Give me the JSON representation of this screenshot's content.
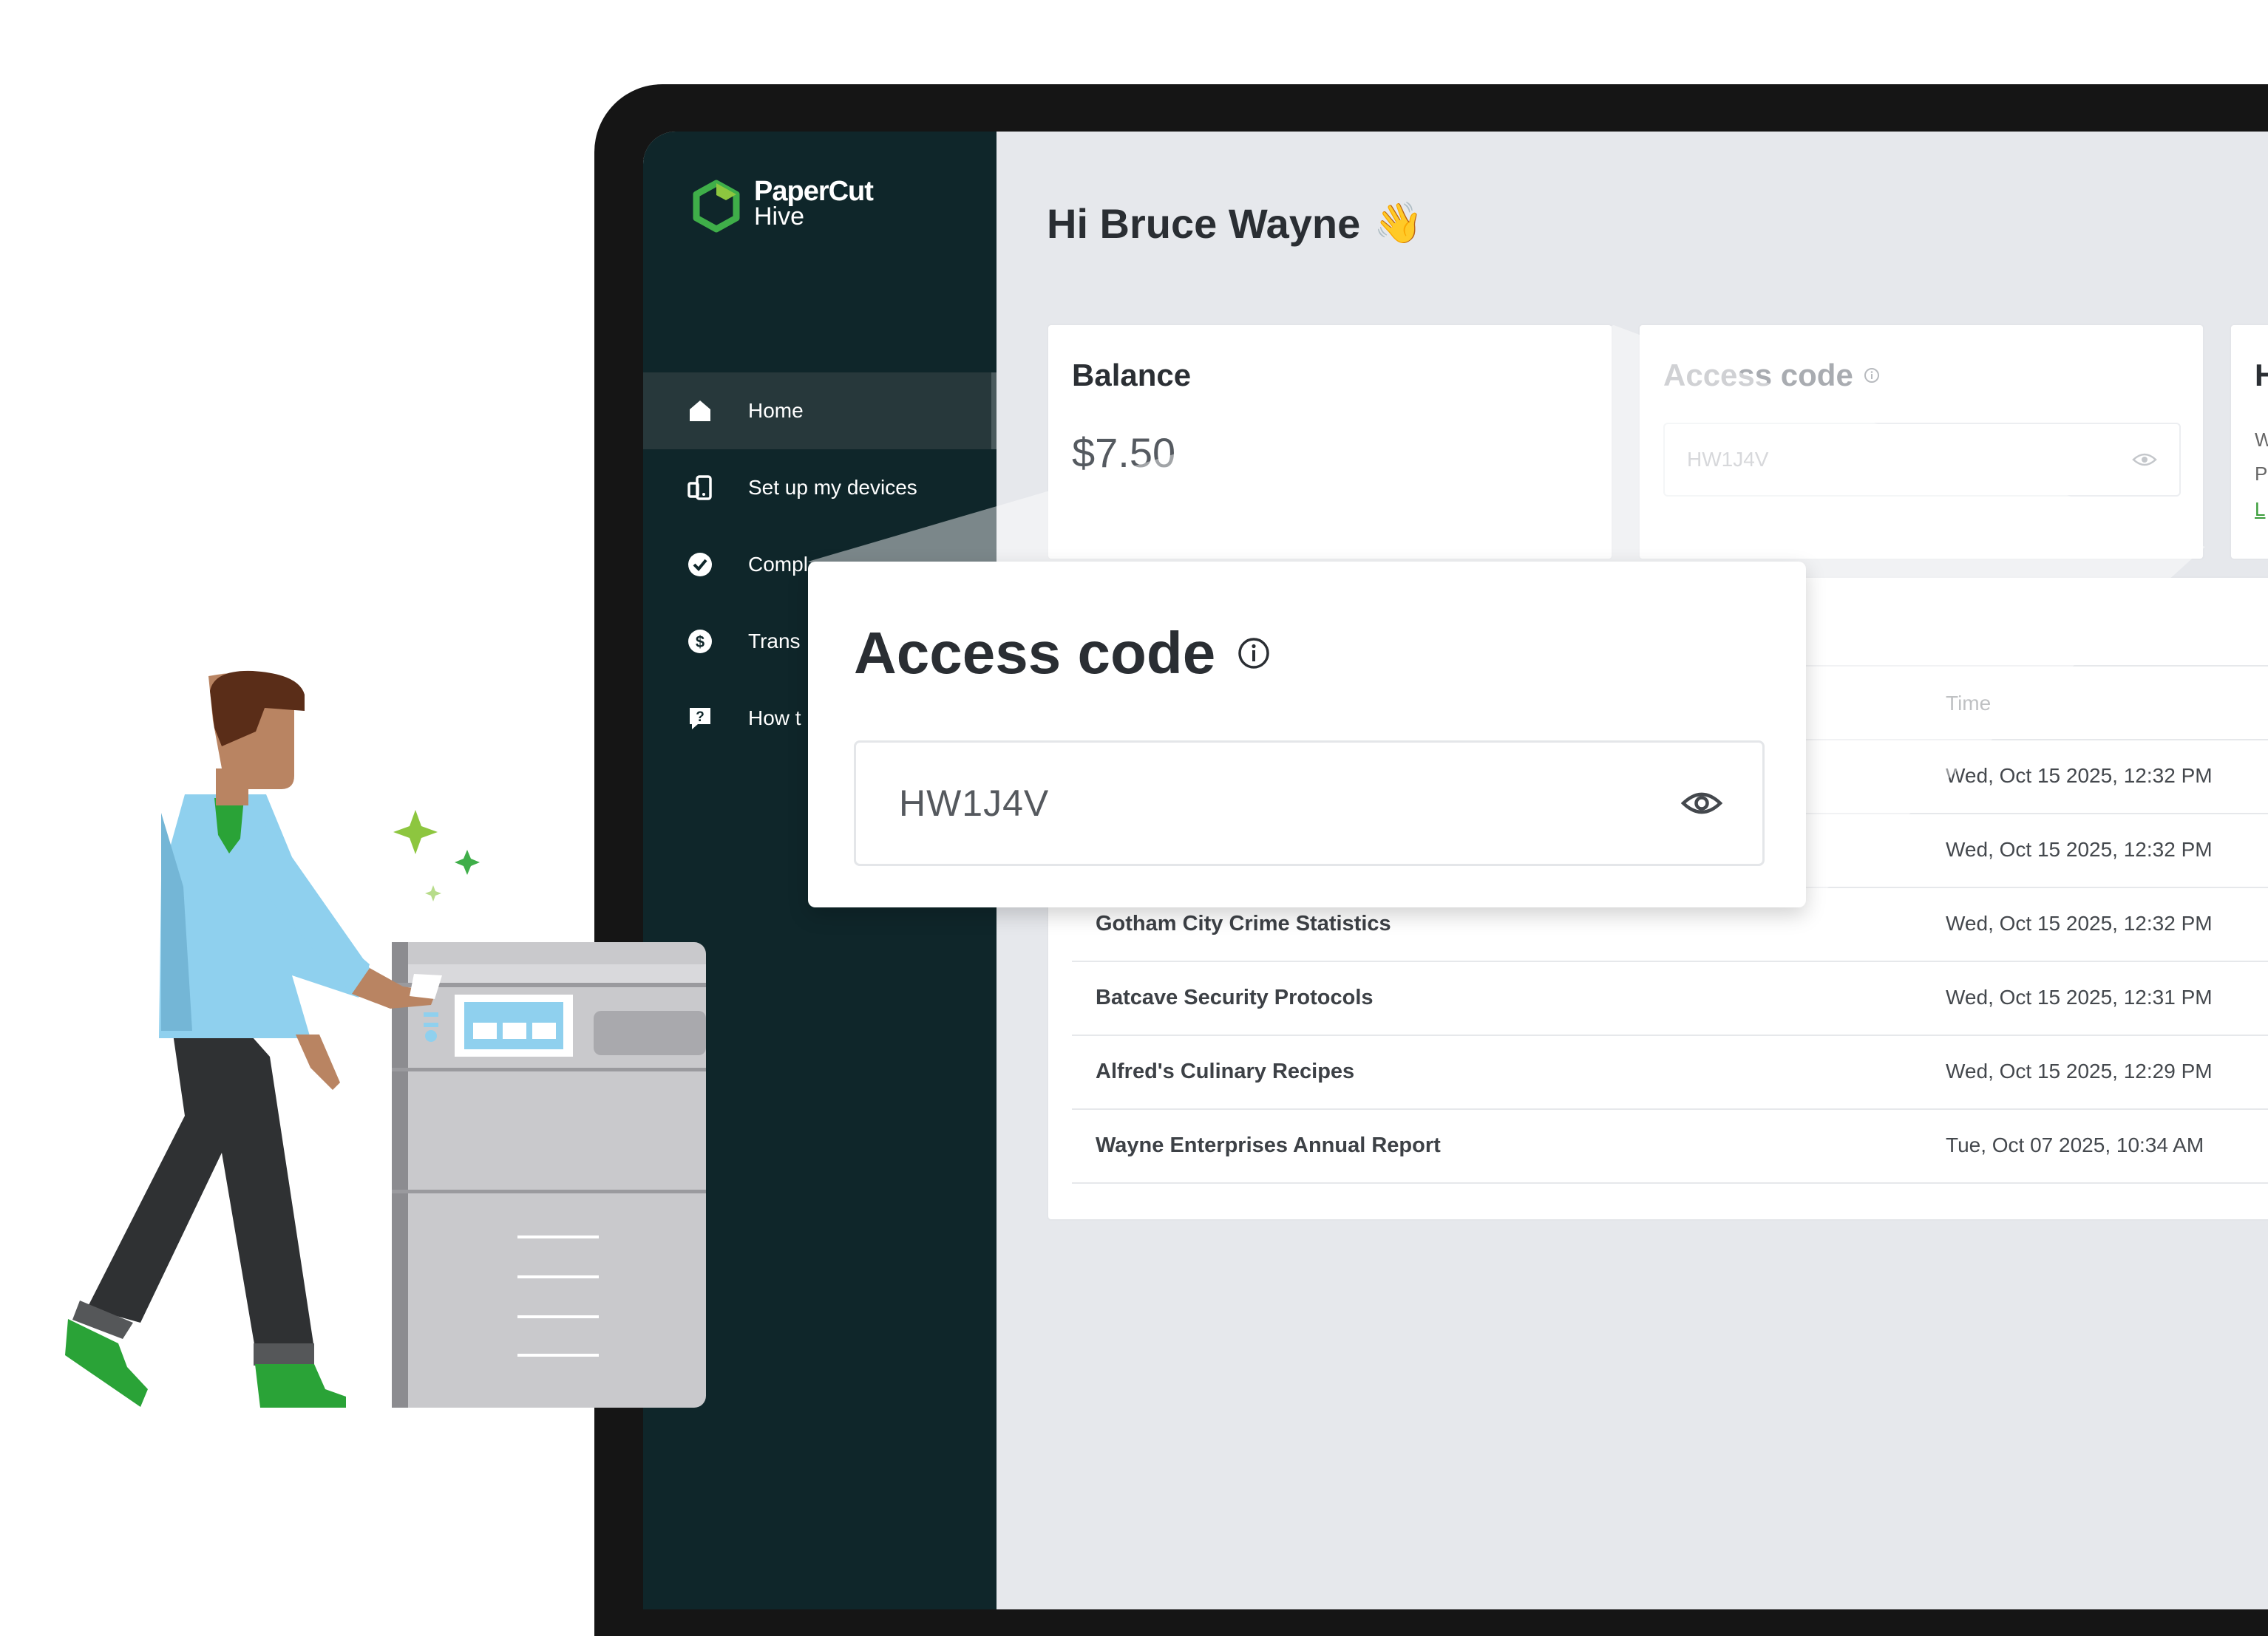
{
  "app": {
    "logo_line1": "PaperCut",
    "logo_line2": "Hive"
  },
  "sidebar": {
    "items": [
      {
        "label": "Home",
        "icon": "home-icon",
        "active": true
      },
      {
        "label": "Set up my devices",
        "icon": "devices-icon",
        "active": false
      },
      {
        "label": "Compl",
        "icon": "check-circle-icon",
        "active": false
      },
      {
        "label": "Trans",
        "icon": "dollar-circle-icon",
        "active": false
      },
      {
        "label": "How t",
        "icon": "help-icon",
        "active": false
      }
    ]
  },
  "header": {
    "greeting": "Hi Bruce Wayne",
    "emoji": "👋"
  },
  "balance": {
    "title": "Balance",
    "value": "$7.50"
  },
  "access_code": {
    "title": "Access code",
    "code": "HW1J4V"
  },
  "third_card": {
    "title": "H",
    "line1": "W",
    "line2": "P",
    "link": "L"
  },
  "jobs": {
    "time_header": "Time",
    "rows": [
      {
        "document": "",
        "time": "Wed, Oct 15 2025, 12:32 PM"
      },
      {
        "document": "",
        "time": "Wed, Oct 15 2025, 12:32 PM"
      },
      {
        "document": "Gotham City Crime Statistics",
        "time": "Wed, Oct 15 2025, 12:32 PM"
      },
      {
        "document": "Batcave Security Protocols",
        "time": "Wed, Oct 15 2025, 12:31 PM"
      },
      {
        "document": "Alfred's Culinary Recipes",
        "time": "Wed, Oct 15 2025, 12:29 PM"
      },
      {
        "document": "Wayne Enterprises Annual Report",
        "time": "Tue, Oct 07 2025, 10:34 AM"
      }
    ]
  },
  "popup": {
    "title": "Access code",
    "code": "HW1J4V"
  },
  "colors": {
    "sidebar_bg": "#0f262a",
    "logo_green": "#3fae49",
    "page_bg": "#e6e8ec"
  }
}
